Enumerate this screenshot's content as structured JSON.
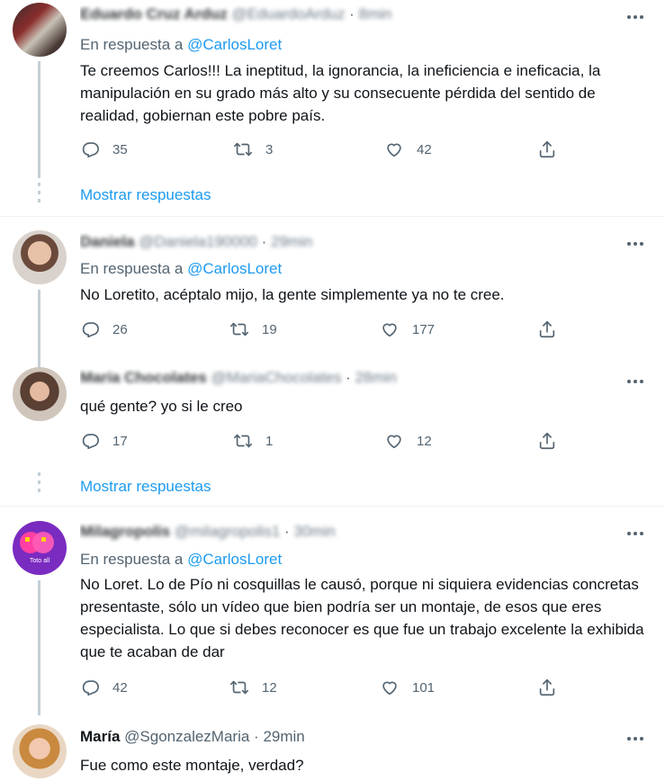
{
  "tweets": [
    {
      "name": "Eduardo Cruz Arduz",
      "handle": "@EduardoArduz",
      "time": "8min",
      "reply_label": "En respuesta a",
      "reply_mention": "@CarlosLoret",
      "text": "Te creemos Carlos!!! La ineptitud, la ignorancia, la ineficiencia e ineficacia, la manipulación en su grado más alto y su consecuente pérdida del sentido de realidad, gobiernan este pobre país.",
      "replies": "35",
      "retweets": "3",
      "likes": "42",
      "show_more": "Mostrar respuestas"
    },
    {
      "name": "Daniela",
      "handle": "@Daniela190000",
      "time": "29min",
      "reply_label": "En respuesta a",
      "reply_mention": "@CarlosLoret",
      "text": "No Loretito, acéptalo mijo, la gente simplemente ya no te cree.",
      "replies": "26",
      "retweets": "19",
      "likes": "177"
    },
    {
      "name": "María Chocolates",
      "handle": "@MariaChocolates",
      "time": "28min",
      "text": "qué gente? yo si le creo",
      "replies": "17",
      "retweets": "1",
      "likes": "12",
      "show_more": "Mostrar respuestas"
    },
    {
      "name": "Milagropolis",
      "handle": "@milagropolis1",
      "time": "30min",
      "reply_label": "En respuesta a",
      "reply_mention": "@CarlosLoret",
      "text": "No Loret.  Lo de Pío ni cosquillas le causó, porque ni siquiera evidencias concretas presentaste, sólo un vídeo que bien podría ser un montaje, de esos que eres especialista.  Lo que si debes reconocer es que fue un trabajo excelente la exhibida que te acaban de dar",
      "replies": "42",
      "retweets": "12",
      "likes": "101"
    },
    {
      "name": "María",
      "handle": "@SgonzalezMaria",
      "time": "29min",
      "text": "Fue como este montaje, verdad?"
    }
  ],
  "separator": "·",
  "avatar_text": "Toto all",
  "icons": {
    "reply": "reply-icon",
    "retweet": "retweet-icon",
    "like": "heart-icon",
    "share": "share-icon",
    "more": "more-icon"
  },
  "colors": {
    "link": "#1d9bf0",
    "muted": "#536471",
    "thread": "#c4cfd6"
  }
}
